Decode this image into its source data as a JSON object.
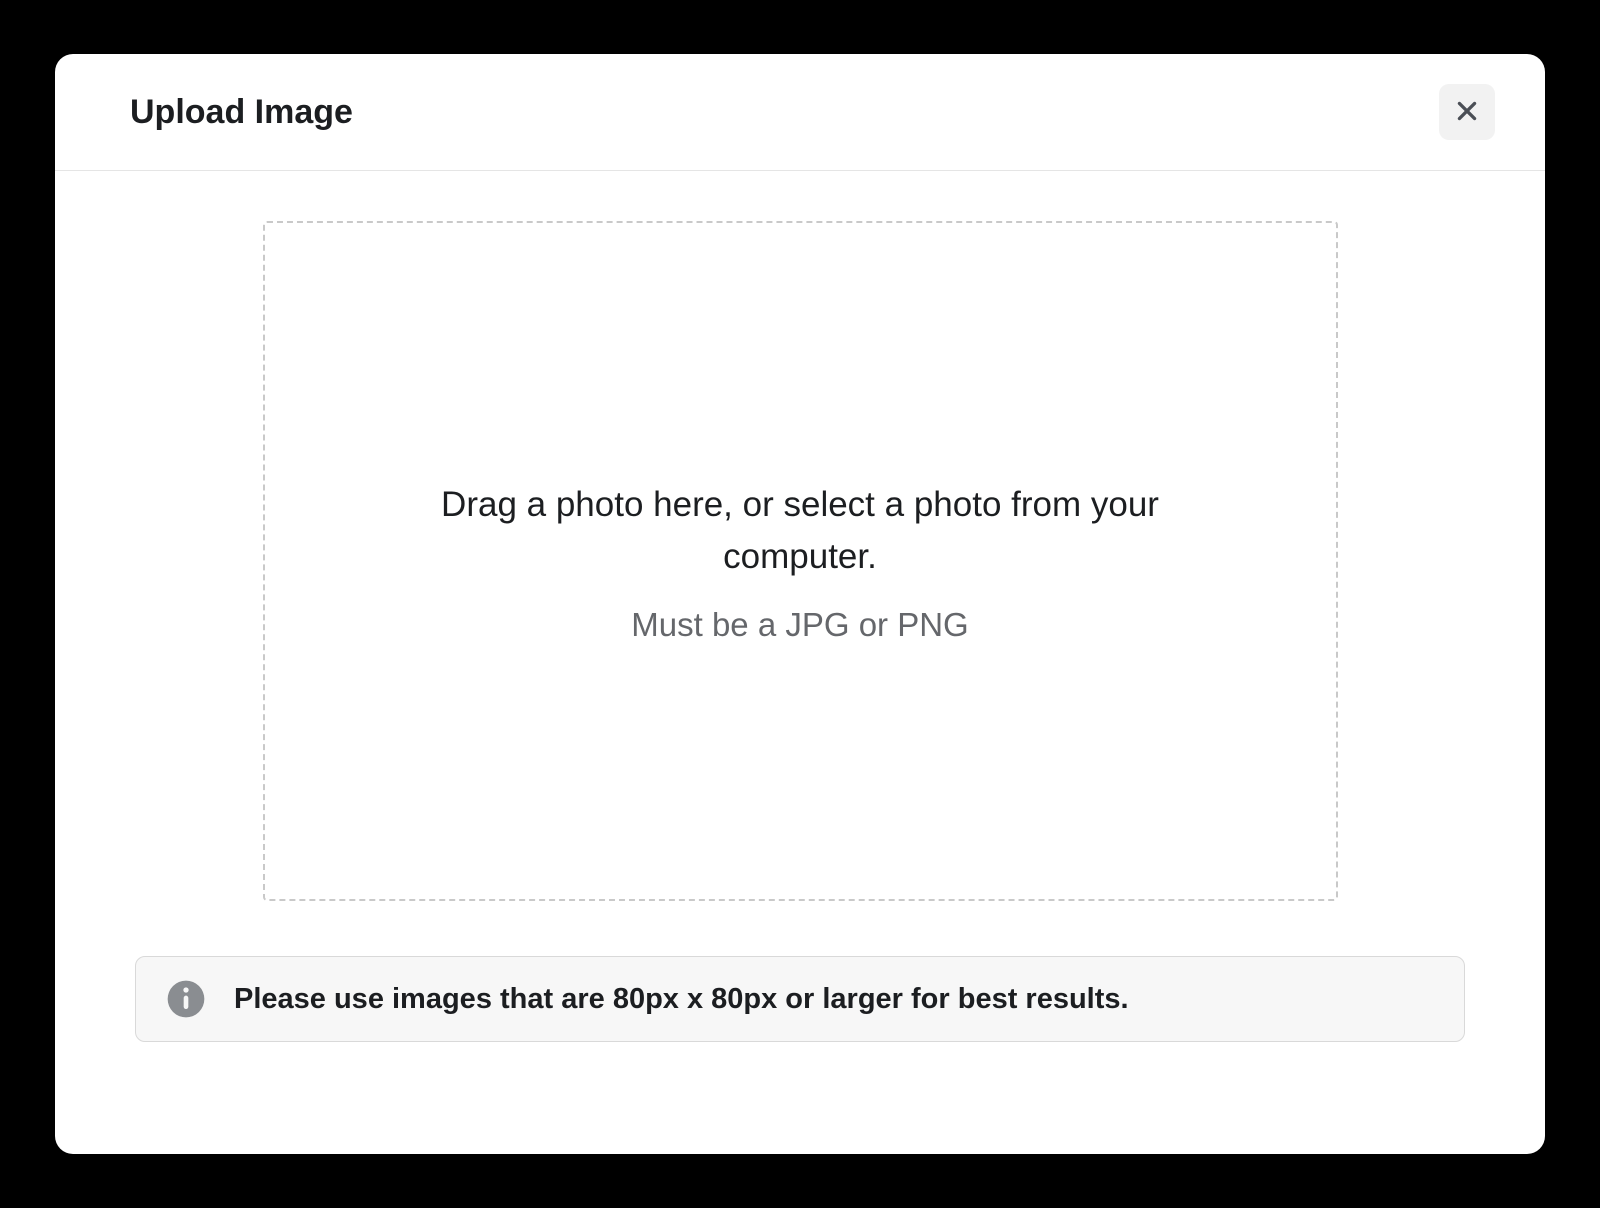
{
  "modal": {
    "title": "Upload Image",
    "dropzone": {
      "primary_text": "Drag a photo here, or select a photo from your computer.",
      "secondary_text": "Must be a JPG or PNG"
    },
    "info_banner": {
      "text": "Please use images that are 80px x 80px or larger for best results."
    }
  }
}
